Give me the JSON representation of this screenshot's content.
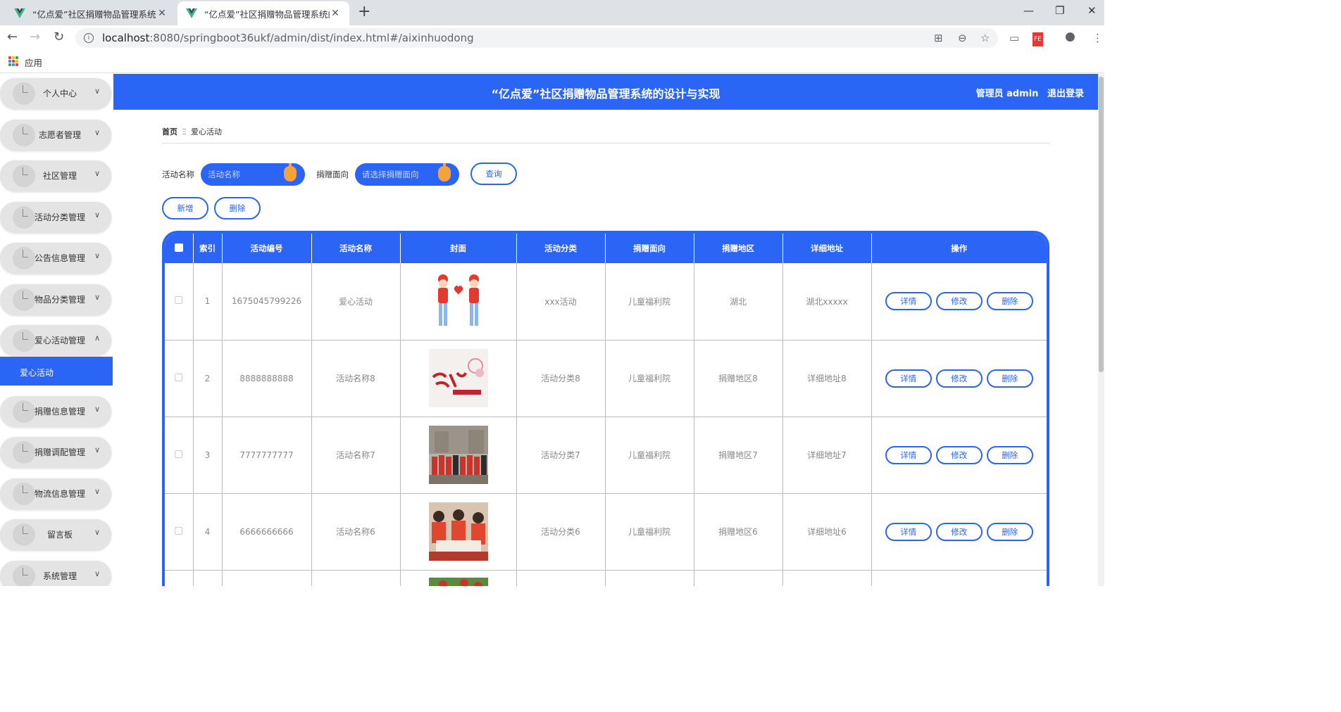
{
  "tabs": [
    {
      "title": "“亿点爱”社区捐赠物品管理系统的设计与实现"
    },
    {
      "title": "“亿点爱”社区捐赠物品管理系统的设计与实现"
    }
  ],
  "url": {
    "host": "localhost",
    "path": ":8080/springboot36ukf/admin/dist/index.html#/aixinhuodong"
  },
  "bm": {
    "apps": "应用"
  },
  "menu": [
    {
      "l": "个人中心"
    },
    {
      "l": "志愿者管理"
    },
    {
      "l": "社区管理"
    },
    {
      "l": "活动分类管理"
    },
    {
      "l": "公告信息管理"
    },
    {
      "l": "物品分类管理"
    },
    {
      "l": "爱心活动管理",
      "exp": true
    },
    {
      "l": "捐赠信息管理"
    },
    {
      "l": "捐赠调配管理"
    },
    {
      "l": "物流信息管理"
    },
    {
      "l": "留言板"
    },
    {
      "l": "系统管理"
    }
  ],
  "sub": "爱心活动",
  "hdr": {
    "title": "“亿点爱”社区捐赠物品管理系统的设计与实现",
    "user": "管理员 admin",
    "logout": "退出登录"
  },
  "bc": {
    "home": "首页",
    "sep": "Ξ",
    "cur": "爱心活动"
  },
  "filt": {
    "nameLbl": "活动名称",
    "namePh": "活动名称",
    "dirLbl": "捐赠面向",
    "dirPh": "请选择捐赠面向",
    "query": "查询",
    "add": "新增",
    "del": "删除"
  },
  "cols": [
    "索引",
    "活动编号",
    "活动名称",
    "封面",
    "活动分类",
    "捐赠面向",
    "捐赠地区",
    "详细地址",
    "操作"
  ],
  "rows": [
    {
      "idx": "1",
      "code": "1675045799226",
      "name": "爱心活动",
      "cat": "xxx活动",
      "dir": "儿童福利院",
      "area": "湖北",
      "addr": "湖北xxxxx",
      "cover": "volunteers-cartoon"
    },
    {
      "idx": "2",
      "code": "8888888888",
      "name": "活动名称8",
      "cat": "活动分类8",
      "dir": "儿童福利院",
      "area": "捐赠地区8",
      "addr": "详细地址8",
      "cover": "volunteer-poster"
    },
    {
      "idx": "3",
      "code": "7777777777",
      "name": "活动名称7",
      "cat": "活动分类7",
      "dir": "儿童福利院",
      "area": "捐赠地区7",
      "addr": "详细地址7",
      "cover": "group-photo"
    },
    {
      "idx": "4",
      "code": "6666666666",
      "name": "活动名称6",
      "cat": "活动分类6",
      "dir": "儿童福利院",
      "area": "捐赠地区6",
      "addr": "详细地址6",
      "cover": "children-activity"
    },
    {
      "idx": "",
      "code": "",
      "name": "",
      "cat": "",
      "dir": "",
      "area": "",
      "addr": "",
      "cover": "outdoor-photo"
    }
  ],
  "act": {
    "detail": "详情",
    "edit": "修改",
    "del": "删除"
  },
  "colors": {
    "primary": "#2b65f5",
    "accent": "#f5a13c"
  }
}
